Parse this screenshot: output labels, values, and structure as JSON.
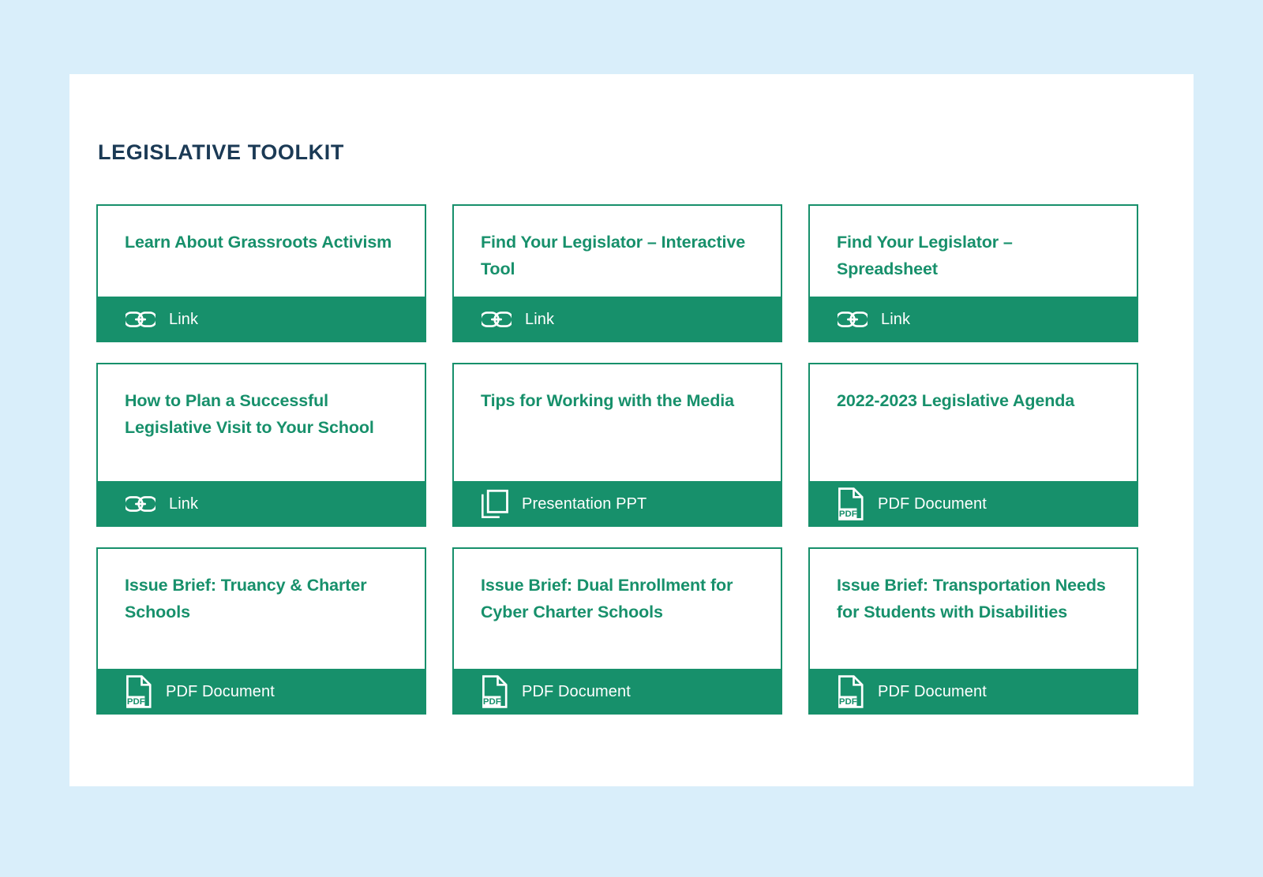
{
  "page": {
    "title": "LEGISLATIVE TOOLKIT",
    "background_color": "#d9eefa",
    "panel_color": "#ffffff",
    "accent_color": "#17906b",
    "title_color": "#1b3a55"
  },
  "cards": [
    {
      "title": "Learn About Grassroots Activism",
      "type_label": "Link",
      "icon": "link-icon"
    },
    {
      "title": "Find Your Legislator – Interactive Tool",
      "type_label": "Link",
      "icon": "link-icon"
    },
    {
      "title": "Find Your Legislator – Spreadsheet",
      "type_label": "Link",
      "icon": "link-icon"
    },
    {
      "title": "How to Plan a Successful Legislative Visit to Your School",
      "type_label": "Link",
      "icon": "link-icon"
    },
    {
      "title": "Tips for Working with the Media",
      "type_label": "Presentation PPT",
      "icon": "presentation-slides-icon"
    },
    {
      "title": "2022-2023 Legislative Agenda",
      "type_label": "PDF Document",
      "icon": "pdf-document-icon"
    },
    {
      "title": "Issue Brief: Truancy & Charter Schools",
      "type_label": "PDF Document",
      "icon": "pdf-document-icon"
    },
    {
      "title": "Issue Brief: Dual Enrollment for Cyber Charter Schools",
      "type_label": "PDF Document",
      "icon": "pdf-document-icon"
    },
    {
      "title": "Issue Brief: Transportation Needs for Students with Disabilities",
      "type_label": "PDF Document",
      "icon": "pdf-document-icon"
    }
  ],
  "icon_glyph_text": {
    "pdf_badge": "PDF"
  }
}
